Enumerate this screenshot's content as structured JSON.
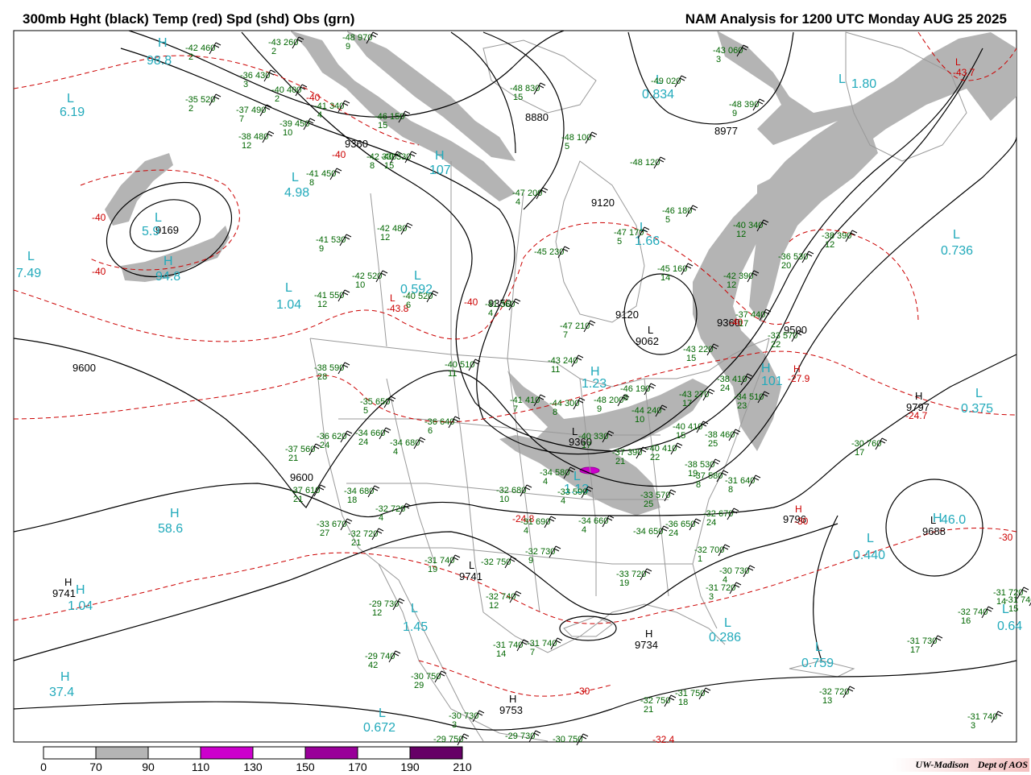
{
  "header": {
    "left_title": "300mb Hght (black) Temp (red) Spd (shd) Obs (grn)",
    "right_title": "NAM Analysis for 1200 UTC Monday  AUG 25 2025"
  },
  "legend": {
    "label": "",
    "ticks": [
      "0",
      "70",
      "90",
      "110",
      "130",
      "150",
      "170",
      "190",
      "210"
    ],
    "bins": [
      {
        "from": "0",
        "to": "70",
        "color": "#ffffff"
      },
      {
        "from": "70",
        "to": "90",
        "color": "#b4b4b4"
      },
      {
        "from": "90",
        "to": "110",
        "color": "#ffffff"
      },
      {
        "from": "110",
        "to": "130",
        "color": "#cc00cc"
      },
      {
        "from": "130",
        "to": "150",
        "color": "#ffffff"
      },
      {
        "from": "150",
        "to": "170",
        "color": "#990099"
      },
      {
        "from": "170",
        "to": "190",
        "color": "#ffffff"
      },
      {
        "from": "190",
        "to": "210",
        "color": "#660066"
      }
    ]
  },
  "credit": {
    "org": "UW-Madison",
    "dept": "Dept of AOS"
  },
  "colors": {
    "height": "#000000",
    "temperature": "#cc0000",
    "obs": "#006600",
    "centers": "#22aabb",
    "borders": "#999999",
    "jet_shade": "#b4b4b4"
  },
  "centers": [
    {
      "type": "H",
      "value": "98.8"
    },
    {
      "type": "L",
      "value": "6.19"
    },
    {
      "type": "L",
      "value": "4.98"
    },
    {
      "type": "L",
      "value": "7.49"
    },
    {
      "type": "H",
      "value": "94.8"
    },
    {
      "type": "L",
      "value": "5.9"
    },
    {
      "type": "L",
      "value": "1.04"
    },
    {
      "type": "L",
      "value": "0.592"
    },
    {
      "type": "H",
      "value": "107"
    },
    {
      "type": "L",
      "value": "0.834"
    },
    {
      "type": "L",
      "value": "1.66"
    },
    {
      "type": "L",
      "value": "1.80"
    },
    {
      "type": "L",
      "value": "0.736"
    },
    {
      "type": "H",
      "value": "1.23"
    },
    {
      "type": "H",
      "value": "101"
    },
    {
      "type": "L",
      "value": "0.375"
    },
    {
      "type": "H",
      "value": "58.6"
    },
    {
      "type": "H",
      "value": "1.04"
    },
    {
      "type": "L",
      "value": "1.45"
    },
    {
      "type": "H",
      "value": "37.4"
    },
    {
      "type": "L",
      "value": "0.672"
    },
    {
      "type": "L",
      "value": "0.286"
    },
    {
      "type": "L",
      "value": "0.759"
    },
    {
      "type": "L",
      "value": "0.440"
    },
    {
      "type": "H",
      "value": "46.0"
    },
    {
      "type": "L",
      "value": "0.64"
    },
    {
      "type": "L",
      "value": "1.13"
    }
  ],
  "height_labels": [
    "8880",
    "8977",
    "9360",
    "9120",
    "9169",
    "9600",
    "9350",
    "9120",
    "9062",
    "9360",
    "9500",
    "9360",
    "9797",
    "9741",
    "9688",
    "9600",
    "9741",
    "9734",
    "9753",
    "9796"
  ],
  "height_centers": [
    "H",
    "H",
    "H",
    "H",
    "L",
    "L",
    "L",
    "L"
  ],
  "temp_labels": [
    "-40",
    "-40",
    "-40",
    "-40",
    "-40",
    "-43.8",
    "-40",
    "-43.7",
    "-27.9",
    "-24.7",
    "-30",
    "-30",
    "-32.4",
    "-24.8",
    "-30"
  ],
  "temp_centers": [
    "L",
    "H",
    "H",
    "L"
  ],
  "obs": [
    {
      "t": "-48",
      "h": "970",
      "d": "9"
    },
    {
      "t": "-42",
      "h": "460",
      "d": "2"
    },
    {
      "t": "-43",
      "h": "260",
      "d": "2"
    },
    {
      "t": "-36",
      "h": "430",
      "d": "3"
    },
    {
      "t": "-40",
      "h": "400",
      "d": "2"
    },
    {
      "t": "-35",
      "h": "520",
      "d": "2"
    },
    {
      "t": "-37",
      "h": "490",
      "d": "7"
    },
    {
      "t": "-41",
      "h": "340",
      "d": "4"
    },
    {
      "t": "-39",
      "h": "450",
      "d": "10"
    },
    {
      "t": "-38",
      "h": "480",
      "d": "12"
    },
    {
      "t": "-41",
      "h": "450",
      "d": "8"
    },
    {
      "t": "-48",
      "h": "830",
      "d": "15"
    },
    {
      "t": "-46",
      "h": "150",
      "d": "15"
    },
    {
      "t": "-40",
      "h": "330",
      "d": "15"
    },
    {
      "t": "-43",
      "h": "060",
      "d": "3"
    },
    {
      "t": "-49",
      "h": "020",
      "d": ""
    },
    {
      "t": "-48",
      "h": "390",
      "d": "9"
    },
    {
      "t": "-48",
      "h": "100",
      "d": "5"
    },
    {
      "t": "-42",
      "h": "330",
      "d": "8"
    },
    {
      "t": "-48",
      "h": "120",
      "d": ""
    },
    {
      "t": "-47",
      "h": "200",
      "d": "4"
    },
    {
      "t": "-46",
      "h": "180",
      "d": "5"
    },
    {
      "t": "-47",
      "h": "170",
      "d": "5"
    },
    {
      "t": "-42",
      "h": "480",
      "d": "12"
    },
    {
      "t": "-41",
      "h": "530",
      "d": "9"
    },
    {
      "t": "-45",
      "h": "230",
      "d": ""
    },
    {
      "t": "-40",
      "h": "340",
      "d": "12"
    },
    {
      "t": "-38",
      "h": "390",
      "d": "12"
    },
    {
      "t": "-36",
      "h": "530",
      "d": "20"
    },
    {
      "t": "-42",
      "h": "520",
      "d": "10"
    },
    {
      "t": "-40",
      "h": "520",
      "d": "6"
    },
    {
      "t": "-41",
      "h": "550",
      "d": "12"
    },
    {
      "t": "-45",
      "h": "160",
      "d": "14"
    },
    {
      "t": "-42",
      "h": "390",
      "d": "12"
    },
    {
      "t": "-41",
      "h": "360",
      "d": "4"
    },
    {
      "t": "-37",
      "h": "440",
      "d": "17"
    },
    {
      "t": "-47",
      "h": "210",
      "d": "7"
    },
    {
      "t": "-33",
      "h": "570",
      "d": "22"
    },
    {
      "t": "-43",
      "h": "220",
      "d": "15"
    },
    {
      "t": "-43",
      "h": "240",
      "d": "11"
    },
    {
      "t": "-40",
      "h": "510",
      "d": "11"
    },
    {
      "t": "-38",
      "h": "590",
      "d": "28"
    },
    {
      "t": "-38",
      "h": "410",
      "d": "24"
    },
    {
      "t": "-34",
      "h": "510",
      "d": "23"
    },
    {
      "t": "-46",
      "h": "190",
      "d": "8"
    },
    {
      "t": "-48",
      "h": "200",
      "d": "9"
    },
    {
      "t": "-44",
      "h": "300",
      "d": "8"
    },
    {
      "t": "-41",
      "h": "410",
      "d": "7"
    },
    {
      "t": "-35",
      "h": "650",
      "d": "5"
    },
    {
      "t": "-44",
      "h": "240",
      "d": "10"
    },
    {
      "t": "-43",
      "h": "270",
      "d": "17"
    },
    {
      "t": "-40",
      "h": "410",
      "d": "15"
    },
    {
      "t": "-38",
      "h": "460",
      "d": "25"
    },
    {
      "t": "-36",
      "h": "640",
      "d": "6"
    },
    {
      "t": "-40",
      "h": "330",
      "d": "17"
    },
    {
      "t": "-40",
      "h": "410",
      "d": "22"
    },
    {
      "t": "-36",
      "h": "620",
      "d": "24"
    },
    {
      "t": "-34",
      "h": "660",
      "d": "24"
    },
    {
      "t": "-34",
      "h": "680",
      "d": "4"
    },
    {
      "t": "-37",
      "h": "560",
      "d": "21"
    },
    {
      "t": "-37",
      "h": "390",
      "d": "21"
    },
    {
      "t": "-38",
      "h": "530",
      "d": "19"
    },
    {
      "t": "-37",
      "h": "580",
      "d": "8"
    },
    {
      "t": "-31",
      "h": "640",
      "d": "8"
    },
    {
      "t": "-30",
      "h": "760",
      "d": "17"
    },
    {
      "t": "-37",
      "h": "610",
      "d": "21"
    },
    {
      "t": "-34",
      "h": "680",
      "d": "18"
    },
    {
      "t": "-32",
      "h": "680",
      "d": "10"
    },
    {
      "t": "-34",
      "h": "580",
      "d": "4"
    },
    {
      "t": "-33",
      "h": "590",
      "d": "4"
    },
    {
      "t": "-33",
      "h": "570",
      "d": "25"
    },
    {
      "t": "-33",
      "h": "670",
      "d": "27"
    },
    {
      "t": "-32",
      "h": "720",
      "d": "4"
    },
    {
      "t": "-32",
      "h": "720",
      "d": "21"
    },
    {
      "t": "-31",
      "h": "690",
      "d": "4"
    },
    {
      "t": "-34",
      "h": "660",
      "d": "4"
    },
    {
      "t": "-32",
      "h": "670",
      "d": "24"
    },
    {
      "t": "-36",
      "h": "650",
      "d": "24"
    },
    {
      "t": "-34",
      "h": "650",
      "d": ""
    },
    {
      "t": "-31",
      "h": "740",
      "d": "19"
    },
    {
      "t": "-32",
      "h": "750",
      "d": ""
    },
    {
      "t": "-32",
      "h": "730",
      "d": "9"
    },
    {
      "t": "-32",
      "h": "700",
      "d": "1"
    },
    {
      "t": "-30",
      "h": "730",
      "d": "4"
    },
    {
      "t": "-33",
      "h": "720",
      "d": "19"
    },
    {
      "t": "-31",
      "h": "720",
      "d": "3"
    },
    {
      "t": "-29",
      "h": "730",
      "d": "12"
    },
    {
      "t": "-32",
      "h": "740",
      "d": "12"
    },
    {
      "t": "-31",
      "h": "740",
      "d": "14"
    },
    {
      "t": "-31",
      "h": "740",
      "d": "7"
    },
    {
      "t": "-29",
      "h": "740",
      "d": "42"
    },
    {
      "t": "-30",
      "h": "750",
      "d": "29"
    },
    {
      "t": "-30",
      "h": "730",
      "d": "3"
    },
    {
      "t": "-29",
      "h": "750",
      "d": ""
    },
    {
      "t": "-29",
      "h": "730",
      "d": ""
    },
    {
      "t": "-30",
      "h": "750",
      "d": ""
    },
    {
      "t": "-32",
      "h": "750",
      "d": "21"
    },
    {
      "t": "-31",
      "h": "750",
      "d": "18"
    },
    {
      "t": "-32",
      "h": "720",
      "d": "13"
    },
    {
      "t": "-31",
      "h": "740",
      "d": "3"
    },
    {
      "t": "-31",
      "h": "730",
      "d": "17"
    },
    {
      "t": "-32",
      "h": "740",
      "d": "16"
    },
    {
      "t": "-31",
      "h": "720",
      "d": "14"
    },
    {
      "t": "-31",
      "h": "740",
      "d": "15"
    }
  ]
}
